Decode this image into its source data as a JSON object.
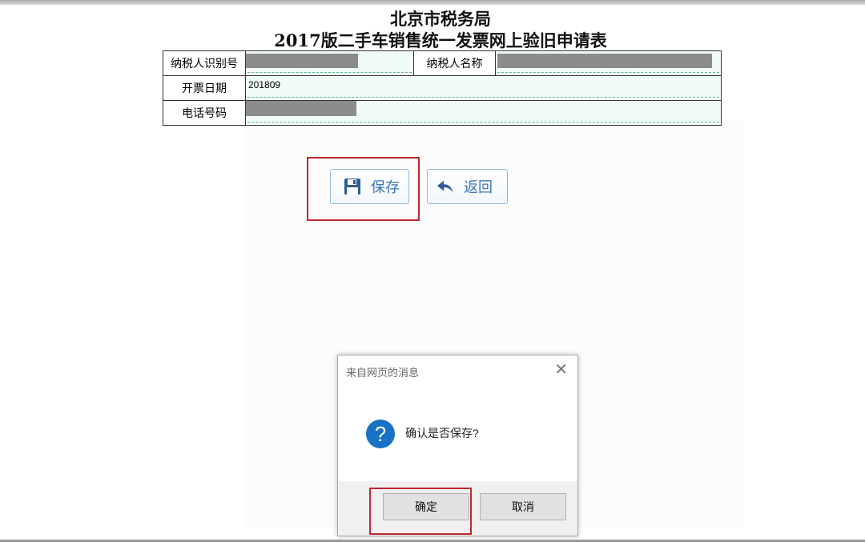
{
  "header": {
    "title_line1": "北京市税务局",
    "title_line2": "2017版二手车销售统一发票网上验旧申请表"
  },
  "form": {
    "taxpayer_id_label": "纳税人识别号",
    "taxpayer_name_label": "纳税人名称",
    "invoice_date_label": "开票日期",
    "invoice_date_value": "201809",
    "phone_label": "电话号码"
  },
  "toolbar": {
    "save_label": "保存",
    "back_label": "返回",
    "save_icon": "floppy-disk-icon",
    "back_icon": "reply-arrow-icon"
  },
  "dialog": {
    "title": "来自网页的消息",
    "message": "确认是否保存?",
    "icon": "question-icon",
    "ok_label": "确定",
    "cancel_label": "取消"
  },
  "colors": {
    "highlight": "#c0282d",
    "button_text": "#3a77b5",
    "field_bg": "#f1fbf6",
    "field_dash": "#58b989",
    "question_icon": "#1a72c7"
  }
}
